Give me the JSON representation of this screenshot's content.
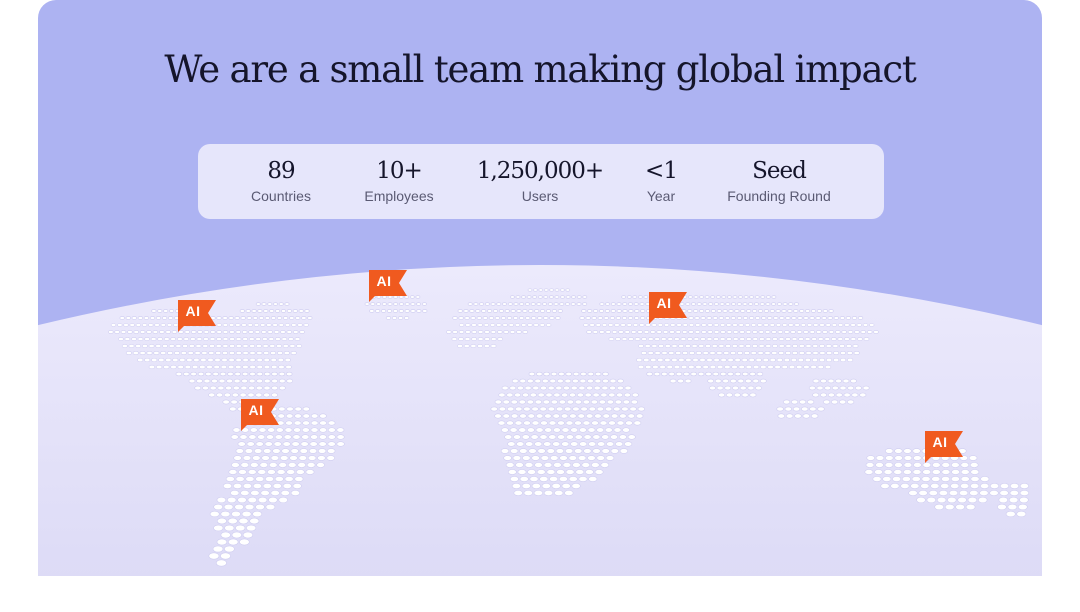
{
  "headline": "We are a small team making global impact",
  "stats": [
    {
      "value": "89",
      "label": "Countries"
    },
    {
      "value": "10+",
      "label": "Employees"
    },
    {
      "value": "1,250,000+",
      "label": "Users"
    },
    {
      "value": "<1",
      "label": "Year"
    },
    {
      "value": "Seed",
      "label": "Founding Round"
    }
  ],
  "pins": [
    {
      "label": "AI",
      "region": "north-america"
    },
    {
      "label": "AI",
      "region": "greenland"
    },
    {
      "label": "AI",
      "region": "south-america"
    },
    {
      "label": "AI",
      "region": "asia"
    },
    {
      "label": "AI",
      "region": "australia"
    }
  ],
  "colors": {
    "background": "#adb3f2",
    "globe": "#e8e7fa",
    "stats_panel": "#e6e6fb",
    "dots": "#ffffff",
    "pin": "#f05a1f",
    "headline": "#15152b"
  }
}
